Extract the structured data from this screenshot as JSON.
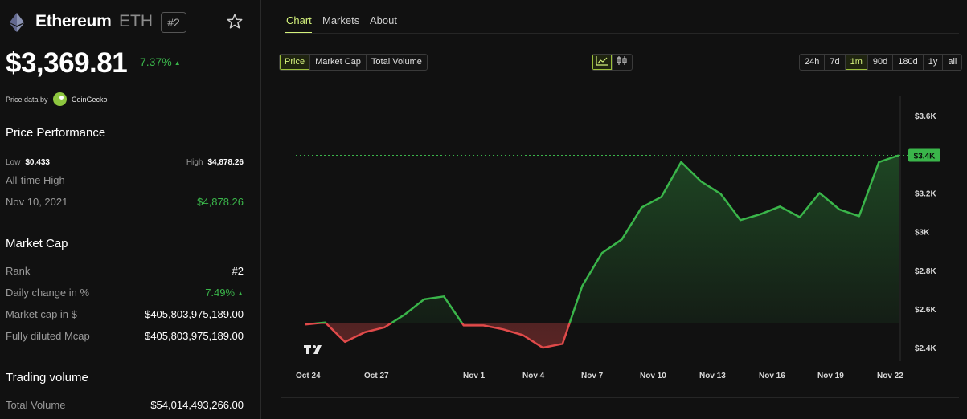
{
  "coin": {
    "name": "Ethereum",
    "symbol": "ETH",
    "rank_badge": "#2",
    "price": "$3,369.81",
    "change": "7.37%",
    "change_arrow": "▲",
    "price_data_label": "Price data by",
    "price_source": "CoinGecko"
  },
  "performance": {
    "title": "Price Performance",
    "low_label": "Low",
    "low_value": "$0.433",
    "high_label": "High",
    "high_value": "$4,878.26",
    "ath_label": "All-time High",
    "ath_date": "Nov 10, 2021",
    "ath_value": "$4,878.26"
  },
  "market_cap": {
    "title": "Market Cap",
    "rank_label": "Rank",
    "rank_value": "#2",
    "daily_label": "Daily change in %",
    "daily_value": "7.49%",
    "mcap_label": "Market cap in $",
    "mcap_value": "$405,803,975,189.00",
    "fdv_label": "Fully diluted Mcap",
    "fdv_value": "$405,803,975,189.00"
  },
  "trading": {
    "title": "Trading volume",
    "total_label": "Total Volume",
    "total_value": "$54,014,493,266.00"
  },
  "tabs": [
    "Chart",
    "Markets",
    "About"
  ],
  "metric_buttons": [
    "Price",
    "Market Cap",
    "Total Volume"
  ],
  "range_buttons": [
    "24h",
    "7d",
    "1m",
    "90d",
    "180d",
    "1y",
    "all"
  ],
  "active_metric": "Price",
  "active_range": "1m",
  "colors": {
    "accent": "#d4f27c",
    "up": "#3ab54a",
    "down": "#e04a4a"
  },
  "chart_data": {
    "type": "area",
    "x_labels": [
      "Oct 24",
      "Oct 27",
      "Nov 1",
      "Nov 4",
      "Nov 7",
      "Nov 10",
      "Nov 13",
      "Nov 16",
      "Nov 19",
      "Nov 22"
    ],
    "y_ticks": [
      "$3.6K",
      "$3.4K",
      "$3.2K",
      "$3K",
      "$2.8K",
      "$2.6K",
      "$2.4K"
    ],
    "y_tick_values": [
      3600,
      3400,
      3200,
      3000,
      2800,
      2600,
      2400
    ],
    "ylim": [
      2330,
      3700
    ],
    "baseline": 2525,
    "current_label": "$3.4K",
    "current_value": 3395,
    "points": [
      2520,
      2530,
      2430,
      2480,
      2505,
      2570,
      2650,
      2665,
      2515,
      2515,
      2495,
      2465,
      2400,
      2420,
      2720,
      2890,
      2960,
      3125,
      3180,
      3360,
      3260,
      3195,
      3060,
      3090,
      3130,
      3075,
      3200,
      3115,
      3080,
      3360,
      3395
    ]
  }
}
